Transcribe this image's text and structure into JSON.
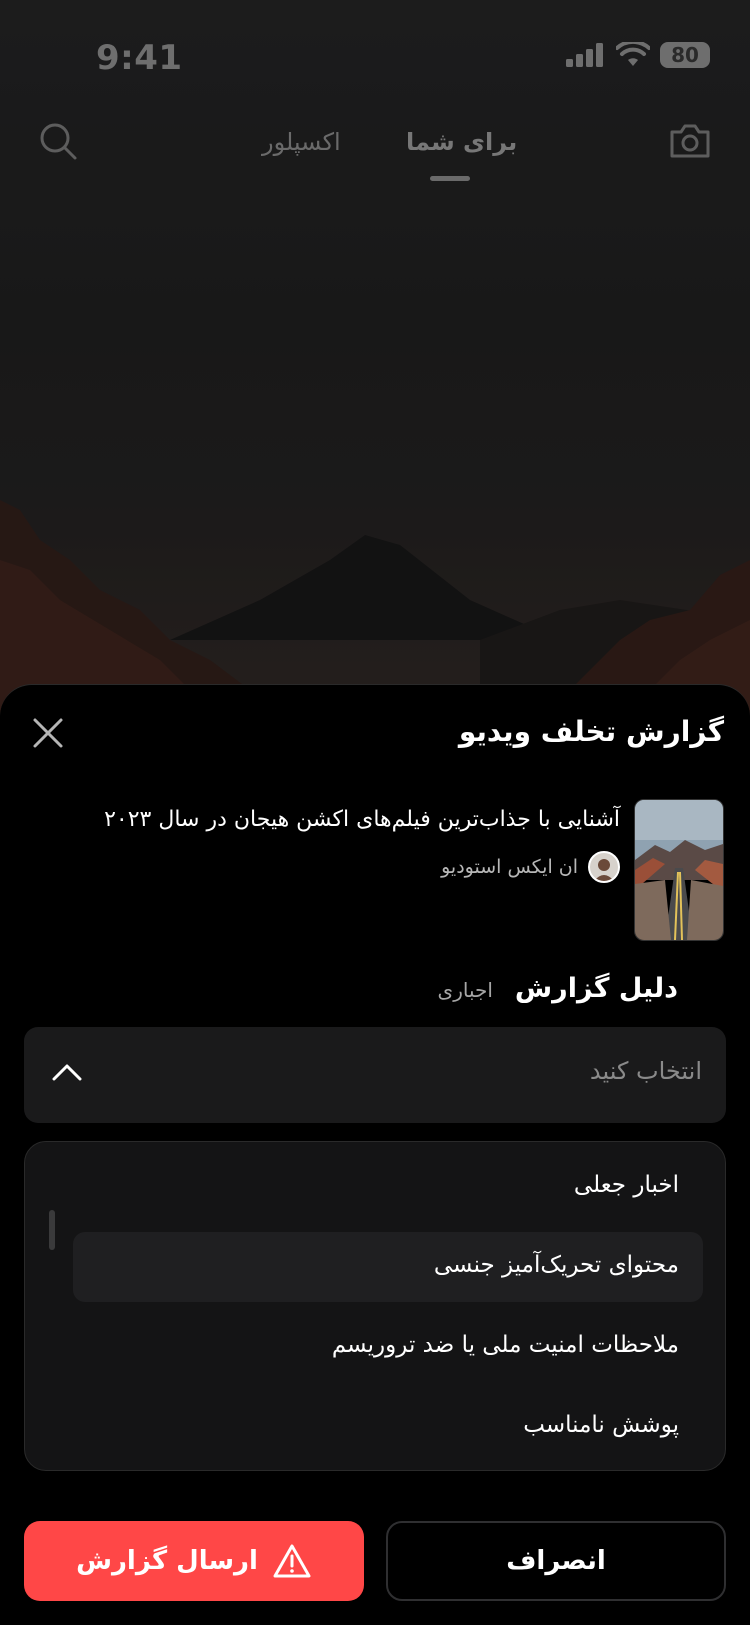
{
  "status_bar": {
    "time": "9:41",
    "battery": "80"
  },
  "nav": {
    "tabs": [
      {
        "label": "برای شما",
        "active": true
      },
      {
        "label": "اکسپلور",
        "active": false
      }
    ]
  },
  "sheet": {
    "title": "گزارش تخلف ویدیو",
    "video": {
      "title": "آشنایی با جذاب‌ترین فیلم‌های اکشن هیجان در سال ۲۰۲۳",
      "channel": "ان ایکس استودیو"
    },
    "reason": {
      "label": "دلیل گزارش",
      "required": "اجباری"
    },
    "select": {
      "placeholder": "انتخاب کنید"
    },
    "options": [
      {
        "label": "اخبار جعلی",
        "selected": false
      },
      {
        "label": "محتوای تحریک‌آمیز جنسی",
        "selected": true
      },
      {
        "label": "ملاحظات امنیت ملی یا ضد تروریسم",
        "selected": false
      },
      {
        "label": "پوشش نامناسب",
        "selected": false
      }
    ],
    "buttons": {
      "submit": "ارسال گزارش",
      "cancel": "انصراف"
    }
  },
  "colors": {
    "accent": "#ff4747",
    "sheet_bg": "#000000",
    "field_bg": "#1a1a1b"
  },
  "icons": [
    "search-icon",
    "camera-icon",
    "close-icon",
    "chevron-up-icon",
    "warning-icon"
  ]
}
